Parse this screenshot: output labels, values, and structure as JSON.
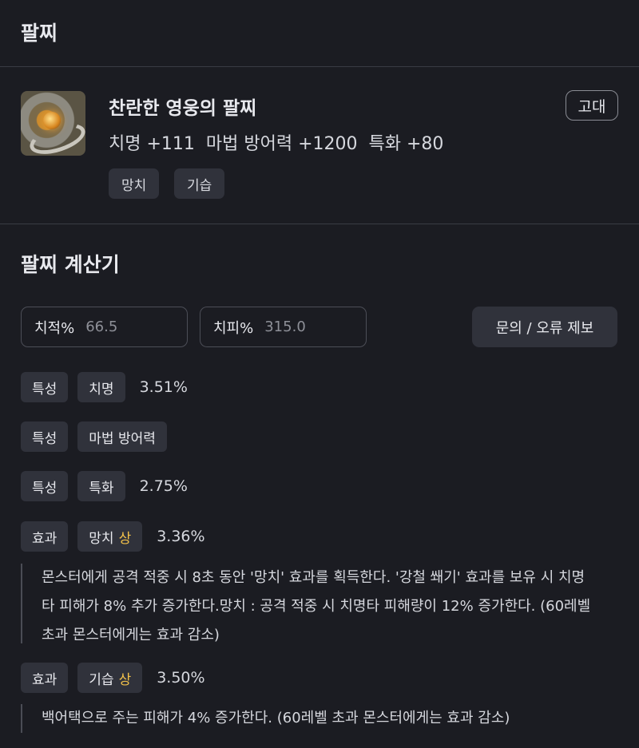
{
  "header": {
    "title": "팔찌"
  },
  "item": {
    "name": "찬란한 영웅의 팔찌",
    "stats": "치명 +111  마법 방어력 +1200  특화 +80",
    "grade": "고대",
    "tags": [
      "망치",
      "기습"
    ],
    "icon": "bracelet-icon"
  },
  "calculator": {
    "title": "팔찌 계산기",
    "crit_rate_label": "치적%",
    "crit_rate_value": "66.5",
    "crit_dmg_label": "치피%",
    "crit_dmg_value": "315.0",
    "report_button": "문의 / 오류 제보"
  },
  "rows": [
    {
      "kind": "특성",
      "name": "치명",
      "value": "3.51%"
    },
    {
      "kind": "특성",
      "name": "마법 방어력",
      "value": ""
    },
    {
      "kind": "특성",
      "name": "특화",
      "value": "2.75%"
    },
    {
      "kind": "효과",
      "name": "망치",
      "grade": "상",
      "value": "3.36%",
      "desc": "몬스터에게 공격 적중 시 8초 동안 '망치' 효과를 획득한다. '강철 쐐기' 효과를 보유 시 치명타 피해가 8% 추가 증가한다.망치 : 공격 적중 시 치명타 피해량이 12% 증가한다. (60레벨 초과 몬스터에게는 효과 감소)"
    },
    {
      "kind": "효과",
      "name": "기습",
      "grade": "상",
      "value": "3.50%",
      "desc": "백어택으로 주는 피해가 4% 증가한다. (60레벨 초과 몬스터에게는 효과 감소)"
    }
  ],
  "colors": {
    "background": "#1b1c22",
    "chip": "#30323b",
    "grade_high": "#f2c14a"
  }
}
